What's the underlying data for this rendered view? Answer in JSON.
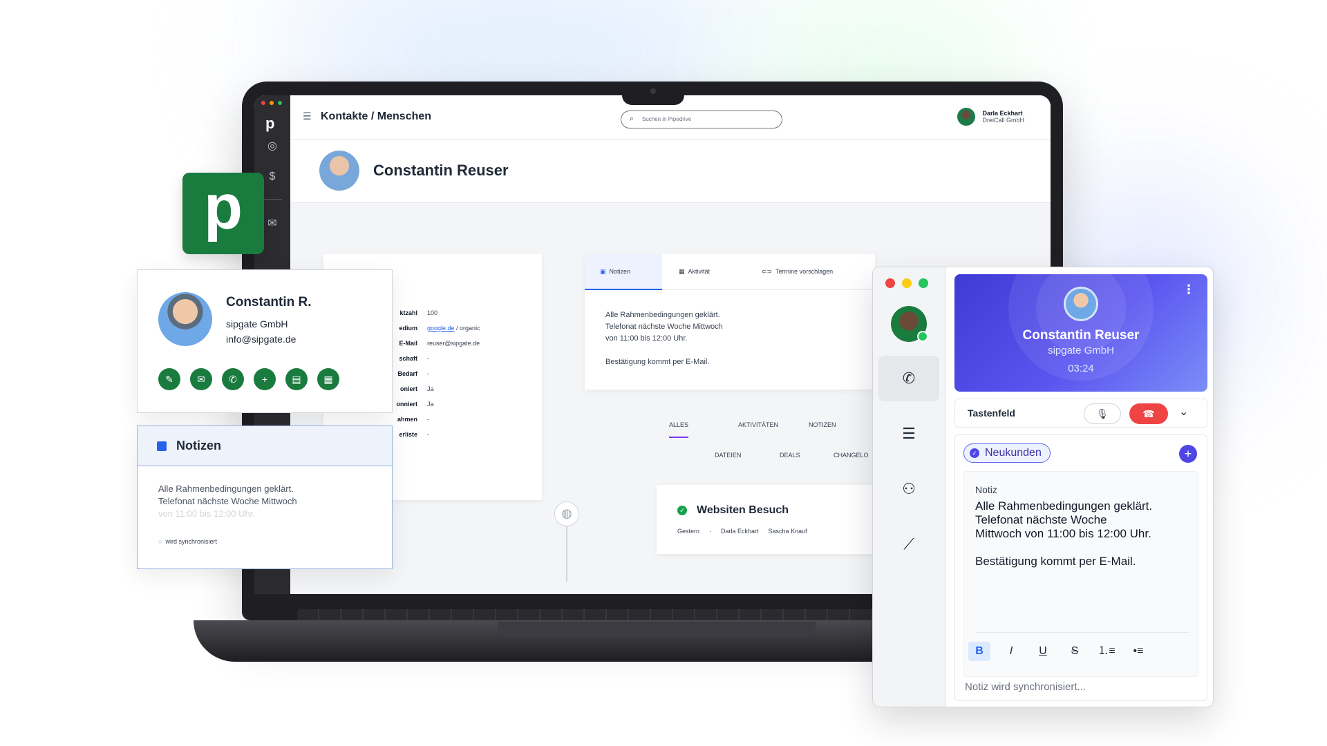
{
  "pipedrive": {
    "logo_letter": "p",
    "breadcrumb": "Kontakte / Menschen",
    "search_placeholder": "Suchen in Pipedrive",
    "user": {
      "name": "Darla Eckhart",
      "company": "DreiCall GmbH"
    },
    "person_name": "Constantin Reuser",
    "details": [
      {
        "label": "ktzahl",
        "value": "100"
      },
      {
        "label": "edium",
        "value_link": "google.de",
        "value": " / organic"
      },
      {
        "label": "E-Mail",
        "value": "reuser@sipgate.de"
      },
      {
        "label": "schaft",
        "value": "-"
      },
      {
        "label": "Bedarf",
        "value": "-"
      },
      {
        "label": "oniert",
        "value": "Ja"
      },
      {
        "label": "onniert",
        "value": "Ja"
      },
      {
        "label": "ahmen",
        "value": "-"
      },
      {
        "label": "erliste",
        "value": "-"
      }
    ],
    "tabs": [
      "Notizen",
      "Aktivität",
      "Termine vorschlagen"
    ],
    "note_lines": [
      "Alle Rahmenbedingungen geklärt.",
      "Telefonat nächste Woche Mittwoch",
      "von 11:00 bis 12:00 Uhr.",
      "",
      "Bestätigung kommt per E-Mail."
    ],
    "filters_row1": [
      "ALLES",
      "AKTIVITÄTEN",
      "NOTIZEN"
    ],
    "filters_row2": [
      "DATEIEN",
      "DEALS",
      "CHANGELO"
    ],
    "activity": {
      "title": "Websiten Besuch",
      "date": "Gestern",
      "owner": "Darla Eckhart",
      "person": "Sascha Knauf"
    }
  },
  "badge": {
    "letter": "p"
  },
  "contact_card": {
    "name": "Constantin R.",
    "company": "sipgate GmbH",
    "email": "info@sipgate.de",
    "actions": [
      "edit-icon",
      "mail-icon",
      "phone-icon",
      "add-icon",
      "calendar-check-icon",
      "calendar-icon"
    ]
  },
  "notes_card": {
    "title": "Notizen",
    "line1": "Alle Rahmenbedingungen geklärt.",
    "line2": "Telefonat nächste Woche Mittwoch",
    "line3": "von 11:00 bis 12:00 Uhr.",
    "sync": "wird synchronisiert"
  },
  "sipgate": {
    "caller_name": "Constantin Reuser",
    "caller_company": "sipgate GmbH",
    "call_timer": "03:24",
    "keypad_label": "Tastenfeld",
    "tag": "Neukunden",
    "note_label": "Notiz",
    "note_text": "Alle Rahmenbedingungen geklärt.\nTelefonat nächste Woche\nMittwoch von 11:00 bis 12:00 Uhr.\n\nBestätigung kommt per E-Mail.",
    "format_buttons": [
      "B",
      "I",
      "U",
      "S",
      "ordered-list-icon",
      "bullet-list-icon"
    ],
    "sync_status": "Notiz wird synchronisiert...",
    "rail": [
      "phone-icon",
      "list-icon",
      "contacts-icon",
      "chart-icon"
    ]
  },
  "colors": {
    "pipedrive_green": "#1a7b3e",
    "sipgate_indigo": "#4f46e5",
    "hangup_red": "#ef4444",
    "online_green": "#22c55e"
  }
}
